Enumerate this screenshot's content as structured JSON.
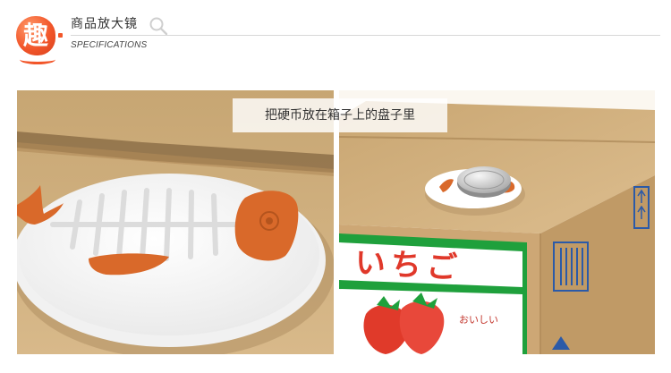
{
  "header": {
    "badge_char": "趣",
    "title": "商品放大镜",
    "subtitle": "SPECIFICATIONS",
    "icon": "search-icon"
  },
  "caption": "把硬币放在箱子上的盘子里",
  "box_label": {
    "main": "いちご",
    "sub": "おいしい"
  },
  "colors": {
    "accent": "#f2562a",
    "cardboard": "#cfae7d",
    "fish": "#d9692a",
    "green": "#1fa03c",
    "blue": "#2b5aa8"
  }
}
